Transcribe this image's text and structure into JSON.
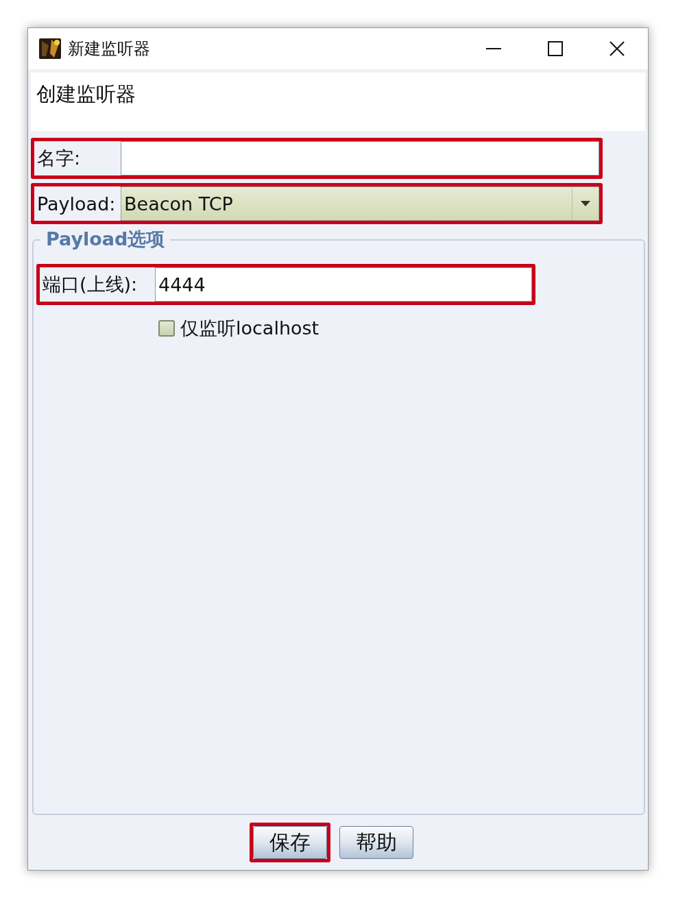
{
  "window": {
    "title": "新建监听器"
  },
  "header": {
    "text": "创建监听器"
  },
  "fields": [
    {
      "kind": "text",
      "label": "名字:",
      "highlighted": true
    },
    {
      "kind": "select",
      "label": "Payload:",
      "value": "Beacon TCP",
      "highlighted": true
    }
  ],
  "options_group": {
    "title": "Payload选项",
    "fields": [
      {
        "kind": "text",
        "label": "端口(上线):",
        "value": "4444",
        "highlighted": true
      },
      {
        "kind": "checkbox",
        "label": "仅监听localhost",
        "checked": false
      }
    ]
  },
  "buttons": [
    {
      "label": "保存",
      "highlighted": true
    },
    {
      "label": "帮助",
      "highlighted": false
    }
  ]
}
